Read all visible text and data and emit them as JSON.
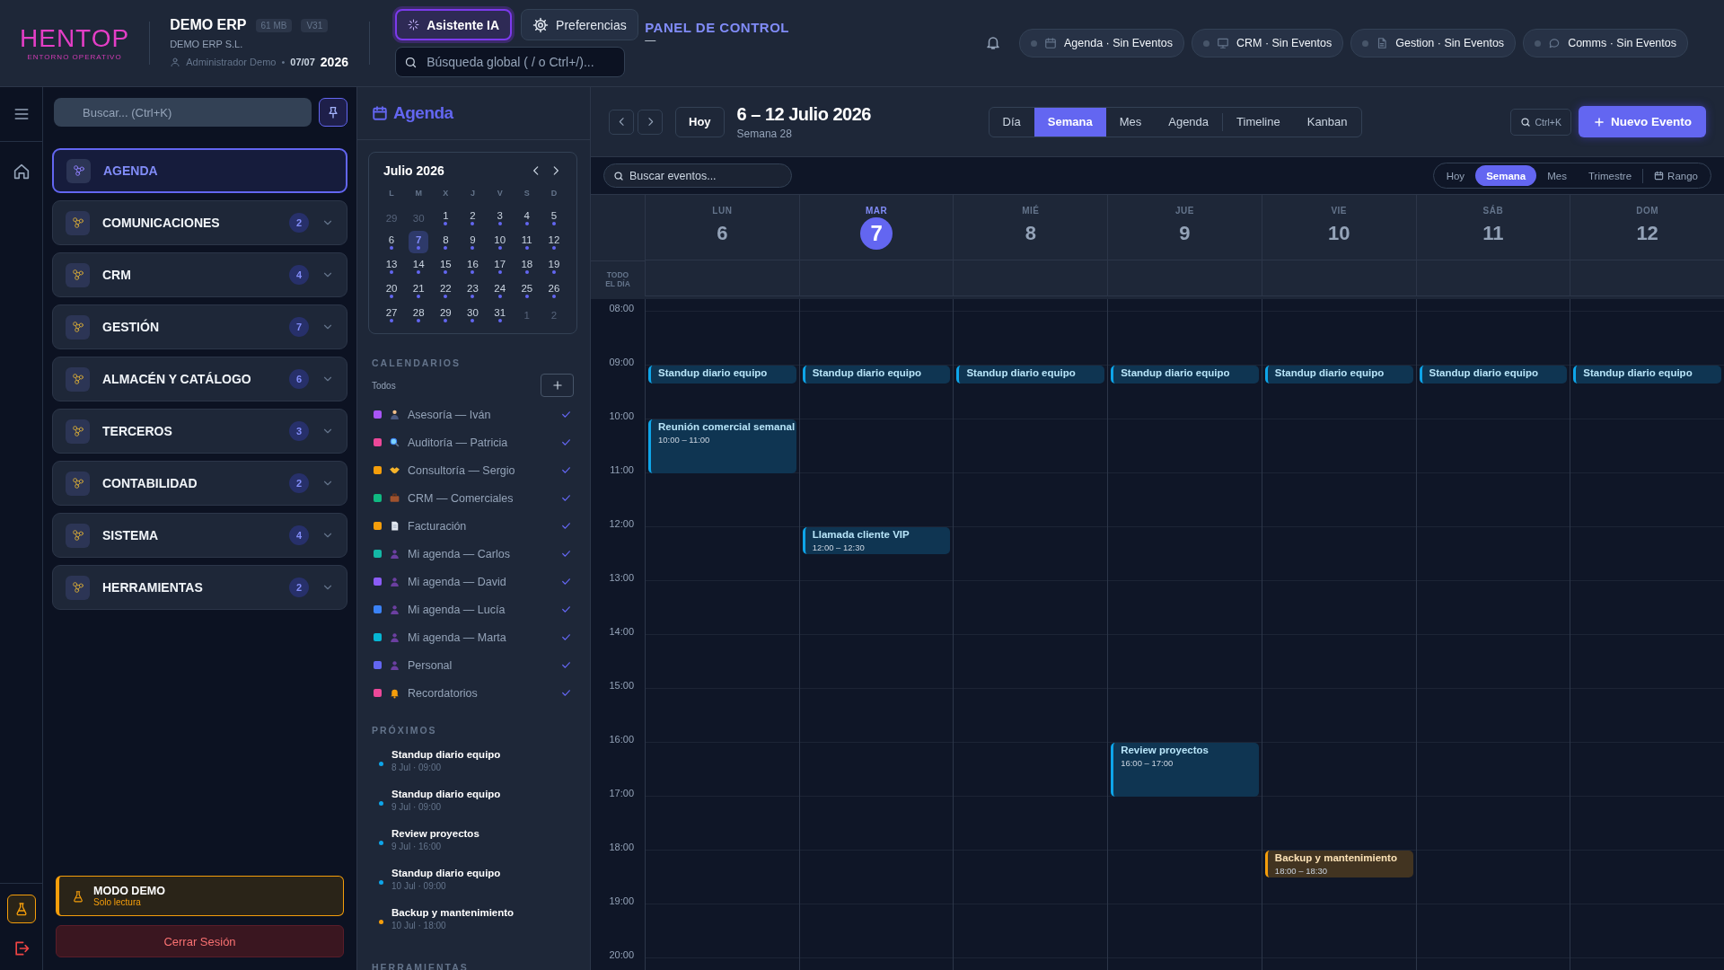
{
  "topbar": {
    "logo": "HENTOP",
    "logo_tagline": "ENTORNO OPERATIVO",
    "app_name": "DEMO ERP",
    "badges": [
      "61 MB",
      "V31"
    ],
    "company": "DEMO ERP S.L.",
    "user": "Administrador Demo",
    "separator": "•",
    "date": "07/07",
    "year": "2026",
    "buttons": [
      {
        "label": "Asistente IA",
        "kind": "assistant",
        "selected": true
      },
      {
        "label": "Preferencias",
        "kind": "settings",
        "selected": false
      }
    ],
    "search": {
      "placeholder": "Búsqueda global ( / o Ctrl+/)..."
    },
    "page_title": "PANEL DE CONTROL",
    "page_subtitle": "—",
    "status_pills": [
      {
        "kind": "calendar",
        "label": "Agenda · Sin Eventos"
      },
      {
        "kind": "monitor",
        "label": "CRM · Sin Eventos"
      },
      {
        "kind": "document",
        "label": "Gestion · Sin Eventos"
      },
      {
        "kind": "chat",
        "label": "Comms · Sin Eventos"
      }
    ]
  },
  "sidebar": {
    "search": {
      "placeholder": "Buscar... (Ctrl+K)"
    },
    "items": [
      {
        "label": "AGENDA",
        "selected": true
      },
      {
        "label": "COMUNICACIONES",
        "count": "2",
        "selected": false
      },
      {
        "label": "CRM",
        "count": "4",
        "selected": false
      },
      {
        "label": "GESTIÓN",
        "count": "7",
        "selected": false
      },
      {
        "label": "ALMACÉN Y CATÁLOGO",
        "count": "6",
        "selected": false
      },
      {
        "label": "TERCEROS",
        "count": "3",
        "selected": false
      },
      {
        "label": "CONTABILIDAD",
        "count": "2",
        "selected": false
      },
      {
        "label": "SISTEMA",
        "count": "4",
        "selected": false
      },
      {
        "label": "HERRAMIENTAS",
        "count": "2",
        "selected": false
      }
    ],
    "demo": {
      "title": "MODO DEMO",
      "subtitle": "Solo lectura"
    },
    "logout": "Cerrar Sesión"
  },
  "agenda_panel": {
    "title": "Agenda",
    "mini_calendar": {
      "month": "Julio 2026",
      "weekdays": [
        "L",
        "M",
        "X",
        "J",
        "V",
        "S",
        "D"
      ],
      "weeks": [
        [
          {
            "d": "29",
            "muted": true,
            "events": false,
            "selected": false
          },
          {
            "d": "30",
            "muted": true,
            "events": false,
            "selected": false
          },
          {
            "d": "1",
            "muted": false,
            "events": true,
            "selected": false
          },
          {
            "d": "2",
            "muted": false,
            "events": true,
            "selected": false
          },
          {
            "d": "3",
            "muted": false,
            "events": true,
            "selected": false
          },
          {
            "d": "4",
            "muted": false,
            "events": true,
            "selected": false
          },
          {
            "d": "5",
            "muted": false,
            "events": true,
            "selected": false
          }
        ],
        [
          {
            "d": "6",
            "muted": false,
            "events": true,
            "selected": false
          },
          {
            "d": "7",
            "muted": false,
            "events": true,
            "selected": true
          },
          {
            "d": "8",
            "muted": false,
            "events": true,
            "selected": false
          },
          {
            "d": "9",
            "muted": false,
            "events": true,
            "selected": false
          },
          {
            "d": "10",
            "muted": false,
            "events": true,
            "selected": false
          },
          {
            "d": "11",
            "muted": false,
            "events": true,
            "selected": false
          },
          {
            "d": "12",
            "muted": false,
            "events": true,
            "selected": false
          }
        ],
        [
          {
            "d": "13",
            "muted": false,
            "events": true,
            "selected": false
          },
          {
            "d": "14",
            "muted": false,
            "events": true,
            "selected": false
          },
          {
            "d": "15",
            "muted": false,
            "events": true,
            "selected": false
          },
          {
            "d": "16",
            "muted": false,
            "events": true,
            "selected": false
          },
          {
            "d": "17",
            "muted": false,
            "events": true,
            "selected": false
          },
          {
            "d": "18",
            "muted": false,
            "events": true,
            "selected": false
          },
          {
            "d": "19",
            "muted": false,
            "events": true,
            "selected": false
          }
        ],
        [
          {
            "d": "20",
            "muted": false,
            "events": true,
            "selected": false
          },
          {
            "d": "21",
            "muted": false,
            "events": true,
            "selected": false
          },
          {
            "d": "22",
            "muted": false,
            "events": true,
            "selected": false
          },
          {
            "d": "23",
            "muted": false,
            "events": true,
            "selected": false
          },
          {
            "d": "24",
            "muted": false,
            "events": true,
            "selected": false
          },
          {
            "d": "25",
            "muted": false,
            "events": true,
            "selected": false
          },
          {
            "d": "26",
            "muted": false,
            "events": true,
            "selected": false
          }
        ],
        [
          {
            "d": "27",
            "muted": false,
            "events": true,
            "selected": false
          },
          {
            "d": "28",
            "muted": false,
            "events": true,
            "selected": false
          },
          {
            "d": "29",
            "muted": false,
            "events": true,
            "selected": false
          },
          {
            "d": "30",
            "muted": false,
            "events": true,
            "selected": false
          },
          {
            "d": "31",
            "muted": false,
            "events": true,
            "selected": false
          },
          {
            "d": "1",
            "muted": true,
            "events": false,
            "selected": false
          },
          {
            "d": "2",
            "muted": true,
            "events": false,
            "selected": false
          }
        ]
      ]
    },
    "calendars_heading": "CALENDARIOS",
    "all_label": "Todos",
    "calendars": [
      {
        "label": "Asesoría — Iván",
        "color": "#a855f7",
        "kind": "person",
        "checked": true
      },
      {
        "label": "Auditoría — Patricia",
        "color": "#ec4899",
        "kind": "magnifier",
        "checked": true
      },
      {
        "label": "Consultoría — Sergio",
        "color": "#f59e0b",
        "kind": "handshake",
        "checked": true
      },
      {
        "label": "CRM — Comerciales",
        "color": "#10b981",
        "kind": "briefcase",
        "checked": true
      },
      {
        "label": "Facturación",
        "color": "#f59e0b",
        "kind": "document",
        "checked": true
      },
      {
        "label": "Mi agenda — Carlos",
        "color": "#14b8a6",
        "kind": "user",
        "checked": true
      },
      {
        "label": "Mi agenda — David",
        "color": "#8b5cf6",
        "kind": "user",
        "checked": true
      },
      {
        "label": "Mi agenda — Lucía",
        "color": "#3b82f6",
        "kind": "user",
        "checked": true
      },
      {
        "label": "Mi agenda — Marta",
        "color": "#06b6d4",
        "kind": "user",
        "checked": true
      },
      {
        "label": "Personal",
        "color": "#6366f1",
        "kind": "user",
        "checked": true
      },
      {
        "label": "Recordatorios",
        "color": "#ec4899",
        "kind": "bell",
        "checked": true
      }
    ],
    "upcoming_heading": "PRÓXIMOS",
    "upcoming": [
      {
        "title": "Standup diario equipo",
        "when": "8 Jul · 09:00",
        "color": "#0ea5e9"
      },
      {
        "title": "Standup diario equipo",
        "when": "9 Jul · 09:00",
        "color": "#0ea5e9"
      },
      {
        "title": "Review proyectos",
        "when": "9 Jul · 16:00",
        "color": "#0ea5e9"
      },
      {
        "title": "Standup diario equipo",
        "when": "10 Jul · 09:00",
        "color": "#0ea5e9"
      },
      {
        "title": "Backup y mantenimiento",
        "when": "10 Jul · 18:00",
        "color": "#f59e0b"
      }
    ],
    "tools_heading": "HERRAMIENTAS"
  },
  "calendar": {
    "toolbar": {
      "today": "Hoy",
      "range": "6 – 12 Julio 2026",
      "week": "Semana 28",
      "views": [
        {
          "label": "Día",
          "selected": false
        },
        {
          "label": "Semana",
          "selected": true
        },
        {
          "label": "Mes",
          "selected": false
        },
        {
          "label": "Agenda",
          "selected": false
        },
        {
          "label": "Timeline",
          "selected": false,
          "separator_before": true
        },
        {
          "label": "Kanban",
          "selected": false
        }
      ],
      "search_hint": "Ctrl+K",
      "new_event": "Nuevo Evento"
    },
    "filter": {
      "placeholder": "Buscar eventos...",
      "periods": [
        {
          "label": "Hoy",
          "selected": false
        },
        {
          "label": "Semana",
          "selected": true
        },
        {
          "label": "Mes",
          "selected": false
        },
        {
          "label": "Trimestre",
          "selected": false
        },
        {
          "label": "Rango",
          "selected": false,
          "kind": "range"
        }
      ]
    },
    "all_day_label": "TODO EL DÍA",
    "days": [
      {
        "dow": "LUN",
        "num": "6",
        "selected": false
      },
      {
        "dow": "MAR",
        "num": "7",
        "selected": true
      },
      {
        "dow": "MIÉ",
        "num": "8",
        "selected": false
      },
      {
        "dow": "JUE",
        "num": "9",
        "selected": false
      },
      {
        "dow": "VIE",
        "num": "10",
        "selected": false
      },
      {
        "dow": "SÁB",
        "num": "11",
        "selected": false
      },
      {
        "dow": "DOM",
        "num": "12",
        "selected": false
      }
    ],
    "hours": [
      {
        "label": "08:00"
      },
      {
        "label": "09:00",
        "cells": [
          {
            "title": "Standup diario equipo",
            "kind": "short",
            "color": "#0ea5e9"
          },
          {
            "title": "Standup diario equipo",
            "kind": "short",
            "color": "#0ea5e9"
          },
          {
            "title": "Standup diario equipo",
            "kind": "short",
            "color": "#0ea5e9"
          },
          {
            "title": "Standup diario equipo",
            "kind": "short",
            "color": "#0ea5e9"
          },
          {
            "title": "Standup diario equipo",
            "kind": "short",
            "color": "#0ea5e9"
          },
          {
            "title": "Standup diario equipo",
            "kind": "short",
            "color": "#0ea5e9"
          },
          {
            "title": "Standup diario equipo",
            "kind": "short",
            "color": "#0ea5e9"
          }
        ]
      },
      {
        "label": "10:00",
        "cells": [
          {
            "title": "Reunión comercial semanal",
            "time": "10:00 – 11:00",
            "kind": "hour",
            "color": "#0ea5e9"
          },
          null,
          null,
          null,
          null,
          null,
          null
        ]
      },
      {
        "label": "11:00"
      },
      {
        "label": "12:00",
        "cells": [
          null,
          {
            "title": "Llamada cliente VIP",
            "time": "12:00 – 12:30",
            "kind": "half",
            "color": "#0ea5e9"
          },
          null,
          null,
          null,
          null,
          null
        ]
      },
      {
        "label": "13:00"
      },
      {
        "label": "14:00"
      },
      {
        "label": "15:00"
      },
      {
        "label": "16:00",
        "cells": [
          null,
          null,
          null,
          {
            "title": "Review proyectos",
            "time": "16:00 – 17:00",
            "kind": "hour",
            "color": "#0ea5e9"
          },
          null,
          null,
          null
        ]
      },
      {
        "label": "17:00"
      },
      {
        "label": "18:00",
        "cells": [
          null,
          null,
          null,
          null,
          {
            "title": "Backup y mantenimiento",
            "time": "18:00 – 18:30",
            "kind": "half",
            "color": "#f59e0b"
          },
          null,
          null
        ]
      },
      {
        "label": "19:00"
      },
      {
        "label": "20:00"
      }
    ]
  }
}
